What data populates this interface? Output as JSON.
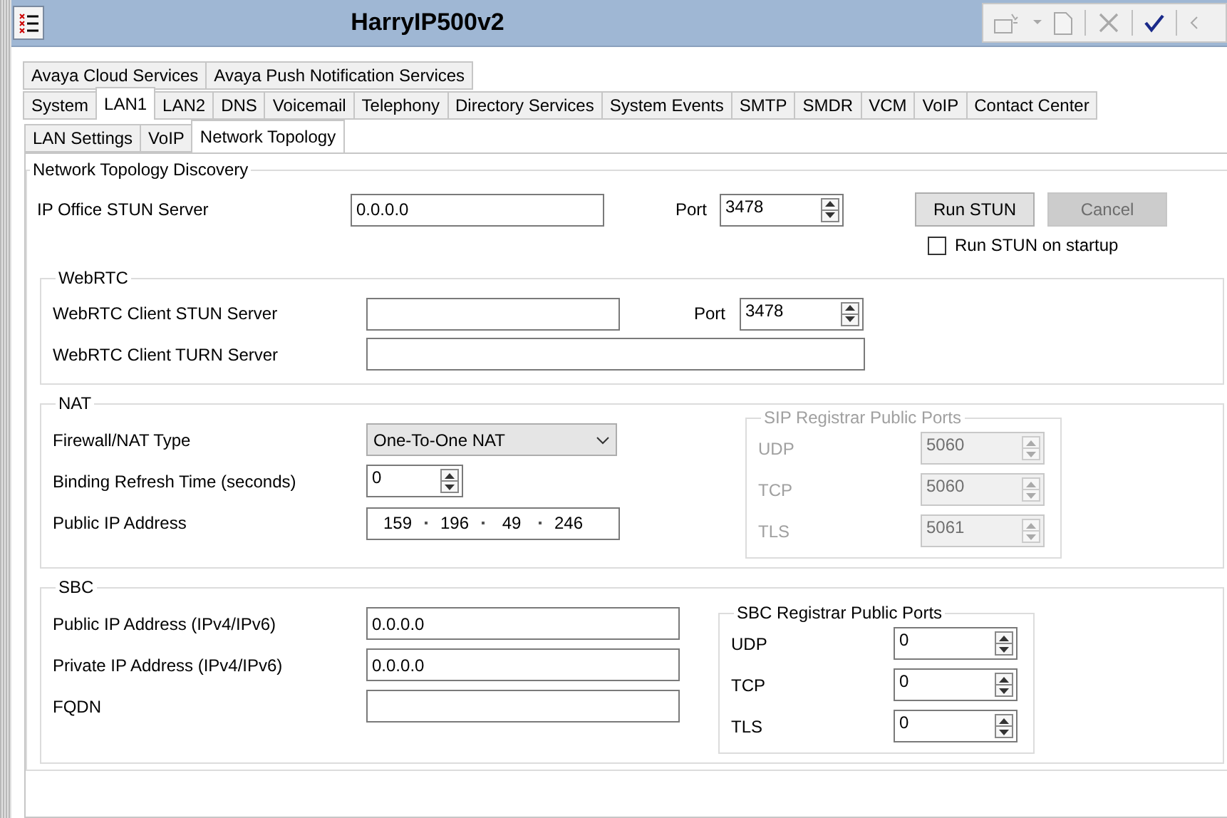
{
  "window": {
    "title": "HarryIP500v2"
  },
  "toolbar": [
    {
      "kind": "new",
      "disabled": true
    },
    {
      "kind": "caret",
      "disabled": true
    },
    {
      "kind": "document",
      "disabled": true
    },
    {
      "kind": "cancel",
      "disabled": true
    },
    {
      "kind": "ok",
      "disabled": false
    },
    {
      "kind": "back",
      "disabled": true
    }
  ],
  "tab_rows": [
    [
      {
        "label": "Avaya Cloud Services",
        "selected": false
      },
      {
        "label": "Avaya Push Notification Services",
        "selected": false
      }
    ],
    [
      {
        "label": "System",
        "selected": false
      },
      {
        "label": "LAN1",
        "selected": true
      },
      {
        "label": "LAN2",
        "selected": false
      },
      {
        "label": "DNS",
        "selected": false
      },
      {
        "label": "Voicemail",
        "selected": false
      },
      {
        "label": "Telephony",
        "selected": false
      },
      {
        "label": "Directory Services",
        "selected": false
      },
      {
        "label": "System Events",
        "selected": false
      },
      {
        "label": "SMTP",
        "selected": false
      },
      {
        "label": "SMDR",
        "selected": false
      },
      {
        "label": "VCM",
        "selected": false
      },
      {
        "label": "VoIP",
        "selected": false
      },
      {
        "label": "Contact Center",
        "selected": false
      }
    ]
  ],
  "subtabs": [
    {
      "label": "LAN Settings",
      "selected": false
    },
    {
      "label": "VoIP",
      "selected": false
    },
    {
      "label": "Network Topology",
      "selected": true
    }
  ],
  "discovery": {
    "title": "Network Topology Discovery",
    "stun_server": {
      "label": "IP Office STUN Server",
      "value": "0.0.0.0"
    },
    "port": {
      "label": "Port",
      "value": "3478"
    },
    "run_button": {
      "label": "Run STUN",
      "disabled": false
    },
    "cancel_button": {
      "label": "Cancel",
      "disabled": true
    },
    "startup": {
      "label": "Run STUN on startup",
      "checked": false
    }
  },
  "webrtc": {
    "title": "WebRTC",
    "stun_server": {
      "label": "WebRTC Client STUN Server"
    },
    "port": {
      "label": "Port",
      "value": "3478"
    },
    "turn_server": {
      "label": "WebRTC Client TURN Server"
    }
  },
  "nat": {
    "title": "NAT",
    "nat_type": {
      "label": "Firewall/NAT Type",
      "value": "One-To-One NAT"
    },
    "binding": {
      "label": "Binding Refresh Time (seconds)",
      "value": "0"
    },
    "public_ip": {
      "label": "Public IP Address",
      "octets": [
        "159",
        "196",
        "49",
        "246"
      ]
    },
    "ports_group": {
      "title": "SIP Registrar Public Ports",
      "disabled": true,
      "ports": [
        {
          "label": "UDP",
          "value": "5060"
        },
        {
          "label": "TCP",
          "value": "5060"
        },
        {
          "label": "TLS",
          "value": "5061"
        }
      ]
    }
  },
  "sbc": {
    "title": "SBC",
    "fields": [
      {
        "label": "Public IP Address (IPv4/IPv6)",
        "value": "0.0.0.0"
      },
      {
        "label": "Private IP Address (IPv4/IPv6)",
        "value": "0.0.0.0"
      },
      {
        "label": "FQDN"
      }
    ],
    "ports_group": {
      "title": "SBC Registrar Public Ports",
      "disabled": false,
      "ports": [
        {
          "label": "UDP",
          "value": "0"
        },
        {
          "label": "TCP",
          "value": "0"
        },
        {
          "label": "TLS",
          "value": "0"
        }
      ]
    }
  }
}
